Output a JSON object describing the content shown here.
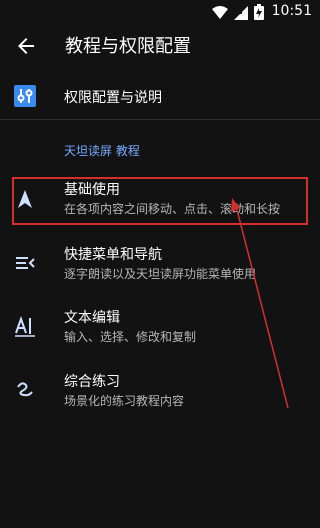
{
  "status_bar": {
    "time": "10:51"
  },
  "app_bar": {
    "title": "教程与权限配置"
  },
  "items": [
    {
      "label": "权限配置与说明"
    }
  ],
  "section_title": "天坦读屏 教程",
  "tutorials": [
    {
      "label": "基础使用",
      "subtitle": "在各项内容之间移动、点击、滚动和长按"
    },
    {
      "label": "快捷菜单和导航",
      "subtitle": "逐字朗读以及天坦读屏功能菜单使用"
    },
    {
      "label": "文本编辑",
      "subtitle": "输入、选择、修改和复制"
    },
    {
      "label": "综合练习",
      "subtitle": "场景化的练习教程内容"
    }
  ],
  "colors": {
    "accent": "#79a8ff",
    "annotation": "#d32f2f",
    "background": "#121212"
  }
}
